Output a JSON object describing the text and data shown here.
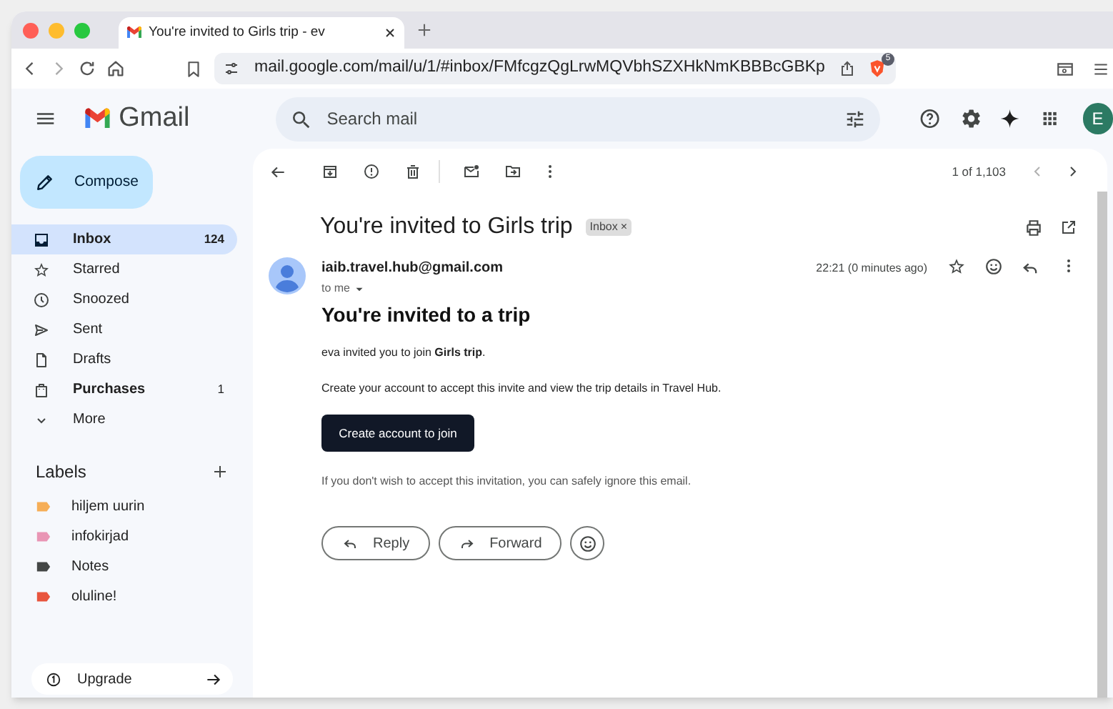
{
  "browser": {
    "tab_title": "You're invited to Girls trip - ev",
    "url": "mail.google.com/mail/u/1/#inbox/FMfcgzQgLrwMQVbhSZXHkNmKBBBcGBKp",
    "shield_badge": "5"
  },
  "header": {
    "app_name": "Gmail",
    "search": {
      "placeholder": "Search mail"
    },
    "avatar": "E"
  },
  "sidebar": {
    "compose": "Compose",
    "items": [
      {
        "label": "Inbox",
        "count": "124",
        "selected": true,
        "unread": true,
        "kind": "inbox"
      },
      {
        "label": "Starred",
        "selected": false,
        "unread": false,
        "kind": "star"
      },
      {
        "label": "Snoozed",
        "selected": false,
        "unread": false,
        "kind": "clock"
      },
      {
        "label": "Sent",
        "selected": false,
        "unread": false,
        "kind": "send"
      },
      {
        "label": "Drafts",
        "selected": false,
        "unread": false,
        "kind": "file"
      },
      {
        "label": "Purchases",
        "count": "1",
        "selected": false,
        "unread": true,
        "kind": "bag"
      },
      {
        "label": "More",
        "selected": false,
        "unread": false,
        "kind": "chevron"
      }
    ],
    "labels_heading": "Labels",
    "labels": [
      {
        "name": "hiljem uurin",
        "color": "#f6ae57"
      },
      {
        "name": "infokirjad",
        "color": "#e996b5"
      },
      {
        "name": "Notes",
        "color": "#444746"
      },
      {
        "name": "oluline!",
        "color": "#e8553e"
      }
    ],
    "upgrade": "Upgrade"
  },
  "message": {
    "counter": "1 of 1,103",
    "subject": "You're invited to Girls trip",
    "tag": "Inbox",
    "tag_close": "×",
    "sender": "iaib.travel.hub@gmail.com",
    "recipient": "to me",
    "time": "22:21 (0 minutes ago)",
    "heading": "You're invited to a trip",
    "paragraphs": [
      "eva invited you to join **Girls trip**.",
      "Create your account to accept this invite and view the trip details in Travel Hub."
    ],
    "cta": "Create account to join",
    "note": "If you don't wish to accept this invitation, you can safely ignore this email.",
    "actions": [
      "Reply",
      "Forward"
    ]
  }
}
